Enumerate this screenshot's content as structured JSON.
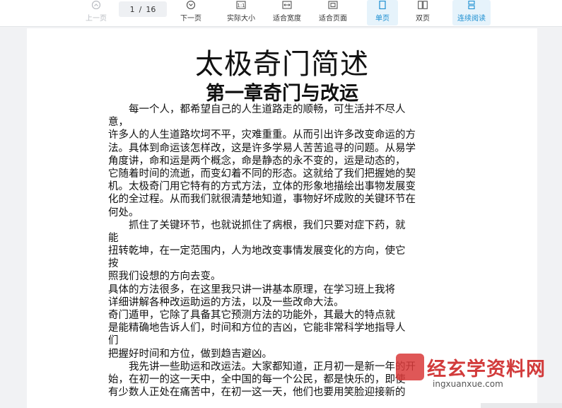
{
  "toolbar": {
    "prev_label": "上一页",
    "page_current": "1",
    "page_sep": "/",
    "page_total": "16",
    "next_label": "下一页",
    "actual_size_label": "实际大小",
    "fit_width_label": "适合宽度",
    "fit_page_label": "适合页面",
    "single_label": "单页",
    "double_label": "双页",
    "continuous_label": "连续阅读",
    "accent_color": "#1a8ed1"
  },
  "document": {
    "title": "太极奇门简述",
    "subtitle": "第一章奇门与改运",
    "lines": [
      "　　每一个人，都希望自己的人生道路走的顺畅，可生活并不尽人",
      "意，",
      "许多人的人生道路坎坷不平，灾难重重。从而引出许多改变命运的方",
      "法。具体到命运该怎样改，这是许多学易人苦苦追寻的问题。从易学",
      "角度讲，命和运是两个概念，命是静态的永不变的，运是动态的，",
      "它随着时间的流逝，而变幻着不同的形态。这就给了我们把握她的契",
      "机。太极奇门用它特有的方式方法，立体的形象地描绘出事物发展变",
      "化的全过程。从而我们就很清楚地知道，事物好坏成败的关键环节在",
      "何处。",
      "　　抓住了关键环节，也就说抓住了病根，我们只要对症下药，就",
      "能",
      "扭转乾坤，在一定范围内，人为地改变事情发展变化的方向，使它",
      "按",
      "照我们设想的方向去变。",
      "具体的方法很多，在这里我只讲一讲基本原理，在学习班上我将",
      "详细讲解各种改运助运的方法，以及一些改命大法。",
      "奇门遁甲，它除了具备其它预测方法的功能外，其最大的特点就",
      "是能精确地告诉人们，时间和方位的吉凶，它能非常科学地指导人",
      "们",
      "把握好时间和方位，做到趋吉避凶。",
      "　　我先讲一些助运和改运法。大家都知道，正月初一是新一年的开",
      "始，在初一的这一天中，全中国的每一个公民，都是快乐的，即使",
      "有少数人正处在痛苦中，在初一这一天，他们也要用笑脸迎接新的"
    ]
  },
  "watermark": {
    "text": "经玄学资料网",
    "url_text": "ingxuanxue.com",
    "color": "#d23b3b"
  }
}
